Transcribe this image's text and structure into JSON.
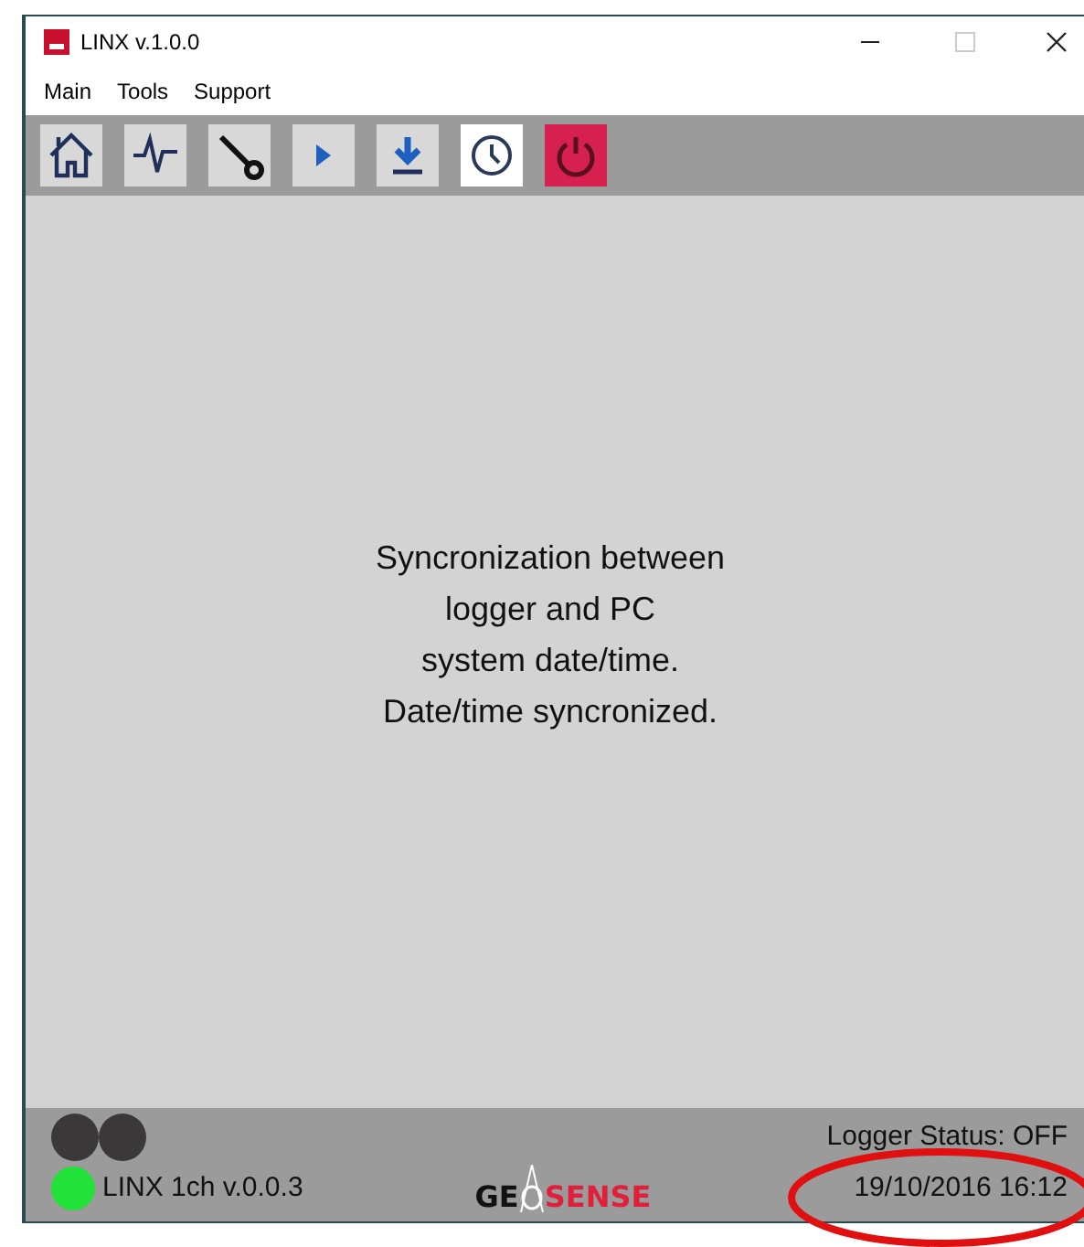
{
  "window": {
    "title": "LINX v.1.0.0"
  },
  "menu": [
    {
      "label": "Main"
    },
    {
      "label": "Tools"
    },
    {
      "label": "Support"
    }
  ],
  "toolbar": [
    {
      "kind": "home",
      "selected": false
    },
    {
      "kind": "signal",
      "selected": false
    },
    {
      "kind": "wrench",
      "selected": false
    },
    {
      "kind": "play",
      "selected": false
    },
    {
      "kind": "download",
      "selected": false
    },
    {
      "kind": "clock",
      "selected": true
    },
    {
      "kind": "power",
      "selected": false
    }
  ],
  "message": [
    "Syncronization between",
    "logger and PC",
    "system date/time.",
    "Date/time syncronized."
  ],
  "status_bar": {
    "lights": [
      {
        "on": false
      },
      {
        "on": false
      }
    ],
    "connection": {
      "on": true,
      "label": "LINX 1ch v.0.0.3"
    },
    "logo": [
      "GE",
      "SENSE"
    ],
    "logger_status": "Logger Status: OFF",
    "datetime": "19/10/2016 16:12"
  }
}
